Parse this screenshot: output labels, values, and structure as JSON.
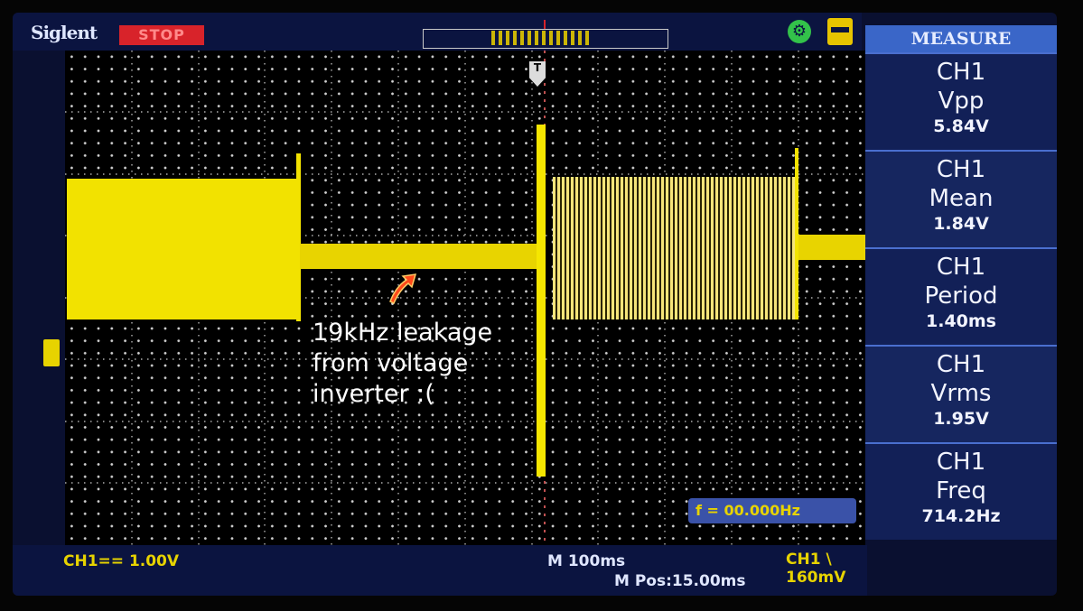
{
  "topbar": {
    "brand": "Siglent",
    "run_state": "STOP",
    "usb_icon": "usb-icon",
    "printer_icon": "printer-icon"
  },
  "annotation": {
    "lines": [
      "19kHz leakage",
      "from voltage",
      "inverter :("
    ]
  },
  "trigger_frequency": "f = 00.000Hz",
  "bottom": {
    "ch1_scale": "CH1== 1.00V",
    "timebase": "M 100ms",
    "trigger_level": "CH1 \\ 160mV",
    "position": "M Pos:15.00ms"
  },
  "measure": {
    "title": "MEASURE",
    "items": [
      {
        "channel": "CH1",
        "name": "Vpp",
        "value": "5.84V"
      },
      {
        "channel": "CH1",
        "name": "Mean",
        "value": "1.84V"
      },
      {
        "channel": "CH1",
        "name": "Period",
        "value": "1.40ms"
      },
      {
        "channel": "CH1",
        "name": "Vrms",
        "value": "1.95V"
      },
      {
        "channel": "CH1",
        "name": "Freq",
        "value": "714.2Hz"
      }
    ]
  },
  "colors": {
    "trace": "#e7d300",
    "background": "#000000",
    "panel": "#0b1440",
    "accent": "#3a66c8",
    "stop": "#d8232a"
  }
}
